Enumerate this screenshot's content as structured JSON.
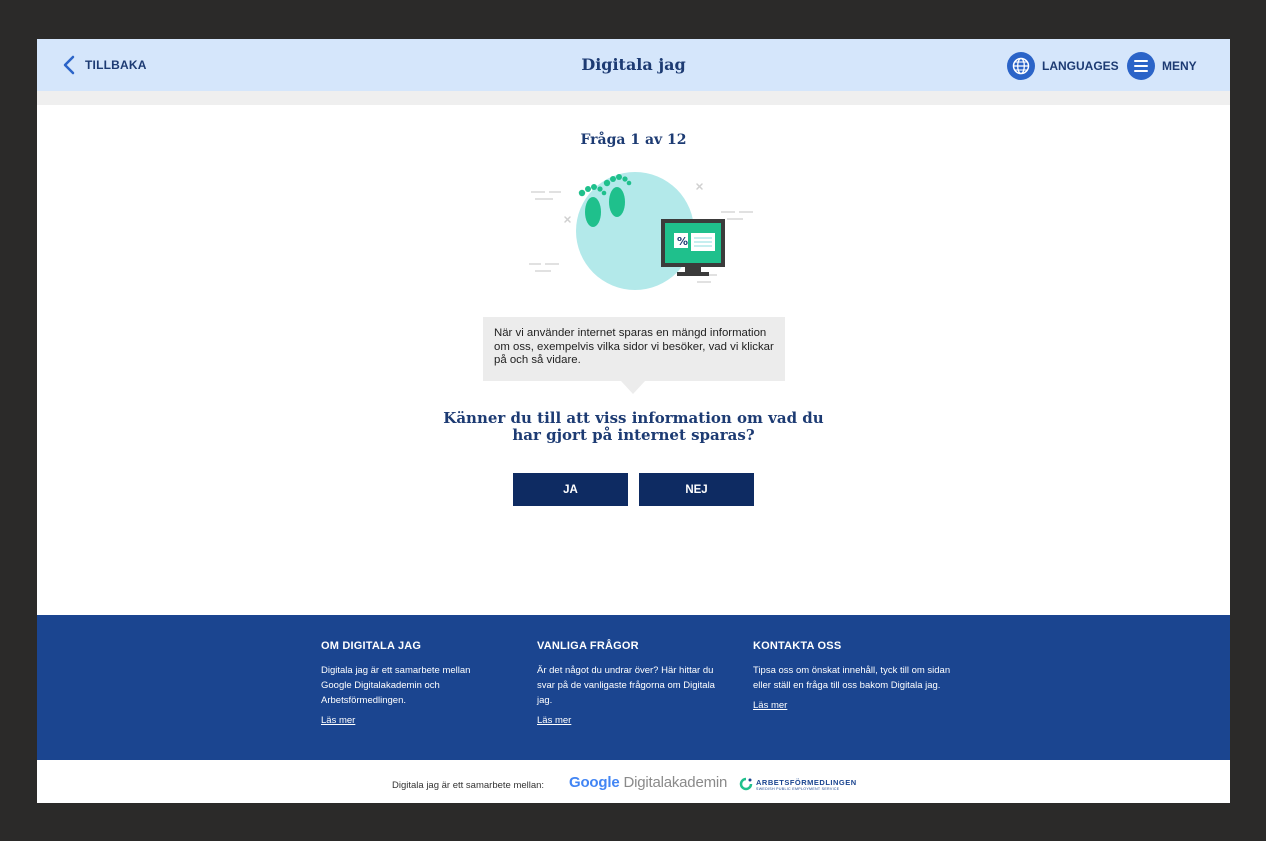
{
  "header": {
    "back_label": "TILLBAKA",
    "title": "Digitala jag",
    "languages_label": "LANGUAGES",
    "menu_label": "MENY"
  },
  "quiz": {
    "progress": "Fråga 1 av 12",
    "info_text": "När vi använder internet sparas en mängd information om oss, exempelvis vilka sidor vi besöker, vad vi klickar på och så vidare.",
    "question": "Känner du till att viss information om vad du har gjort på internet sparas?",
    "answer_yes": "JA",
    "answer_no": "NEJ"
  },
  "footer": {
    "columns": [
      {
        "heading": "OM DIGITALA JAG",
        "text": "Digitala jag är ett samarbete mellan Google Digitalakademin och Arbetsförmedlingen.",
        "link": "Läs mer"
      },
      {
        "heading": "VANLIGA FRÅGOR",
        "text": "Är det något du undrar över? Här hittar du svar på de vanligaste frågorna om Digitala jag.",
        "link": "Läs mer"
      },
      {
        "heading": "KONTAKTA OSS",
        "text": "Tipsa oss om önskat innehåll, tyck till om sidan eller ställ en fråga till oss bakom Digitala jag.",
        "link": "Läs mer"
      }
    ],
    "partners_label": "Digitala jag är ett samarbete mellan:",
    "google_brand": "Google",
    "google_product": "Digitalakademin",
    "af_name": "ARBETSFÖRMEDLINGEN",
    "af_sub": "SWEDISH PUBLIC EMPLOYMENT SERVICE"
  },
  "colors": {
    "header_bg": "#d5e6fb",
    "brand_navy": "#1d3b73",
    "button_bg": "#0e2b62",
    "footer_bg": "#1b4590",
    "accent_blue": "#2b64c8"
  },
  "icons": [
    "chevron-left-icon",
    "globe-icon",
    "menu-icon",
    "footprints-monitor-illustration",
    "arbetsformedlingen-logo-icon"
  ]
}
